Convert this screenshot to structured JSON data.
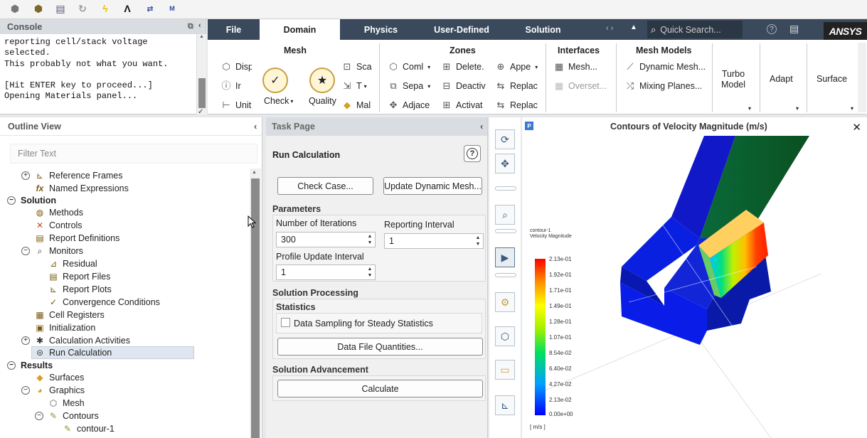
{
  "toolbar": {
    "icons": [
      "read-case-icon",
      "write-case-icon",
      "save-icon",
      "reload-icon",
      "lightning-icon",
      "ansys-logo-icon",
      "swap-icon",
      "units-icon"
    ]
  },
  "console": {
    "title": "Console",
    "lines": [
      "reporting cell/stack voltage",
      "selected.",
      "This probably not what you want.",
      "",
      "[Hit ENTER key to proceed...]",
      "Opening Materials panel..."
    ]
  },
  "ribbon": {
    "tabs": [
      "File",
      "Domain",
      "Physics",
      "User-Defined",
      "Solution"
    ],
    "active_tab": "Domain",
    "search_placeholder": "Quick Search...",
    "brand": "ANSYS",
    "groups": {
      "mesh": {
        "title": "Mesh",
        "items": [
          "Disp",
          "Ir",
          "Unit",
          "Sca",
          "T",
          "Mal"
        ],
        "check": "Check",
        "quality": "Quality"
      },
      "zones": {
        "title": "Zones",
        "items": [
          "Coml",
          "Sepa",
          "Adjace",
          "Delete.",
          "Deactiv",
          "Activat",
          "Appe",
          "Replac",
          "Replac"
        ]
      },
      "interfaces": {
        "title": "Interfaces",
        "items": [
          "Mesh...",
          "Overset..."
        ]
      },
      "mesh_models": {
        "title": "Mesh Models",
        "items": [
          "Dynamic Mesh...",
          "Mixing Planes..."
        ]
      },
      "turbo": {
        "line1": "Turbo",
        "line2": "Model"
      },
      "adapt": "Adapt",
      "surface": "Surface"
    }
  },
  "outline": {
    "title": "Outline View",
    "filter_placeholder": "Filter Text",
    "nodes": [
      "Reference Frames",
      "Named Expressions",
      "Solution",
      "Methods",
      "Controls",
      "Report Definitions",
      "Monitors",
      "Residual",
      "Report Files",
      "Report Plots",
      "Convergence Conditions",
      "Cell Registers",
      "Initialization",
      "Calculation Activities",
      "Run Calculation",
      "Results",
      "Surfaces",
      "Graphics",
      "Mesh",
      "Contours",
      "contour-1"
    ]
  },
  "task": {
    "title": "Task Page",
    "heading": "Run Calculation",
    "check_case": "Check Case...",
    "update_mesh": "Update Dynamic Mesh...",
    "parameters": "Parameters",
    "num_iter_label": "Number of Iterations",
    "num_iter": "300",
    "report_interval_label": "Reporting Interval",
    "report_interval": "1",
    "profile_label": "Profile Update Interval",
    "profile_interval": "1",
    "solution_processing": "Solution Processing",
    "statistics": "Statistics",
    "data_sampling": "Data Sampling for Steady Statistics",
    "data_file_quantities": "Data File Quantities...",
    "solution_advancement": "Solution Advancement",
    "calculate": "Calculate"
  },
  "viewer": {
    "title": "Contours of Velocity Magnitude (m/s)",
    "legend_line1": "contour-1",
    "legend_line2": "Velocity Magnitude",
    "unit": "[ m/s ]",
    "colorbar_labels": [
      "2.13e-01",
      "1.92e-01",
      "1.71e-01",
      "1.49e-01",
      "1.28e-01",
      "1.07e-01",
      "8.54e-02",
      "6.40e-02",
      "4.27e-02",
      "2.13e-02",
      "0.00e+00"
    ]
  }
}
